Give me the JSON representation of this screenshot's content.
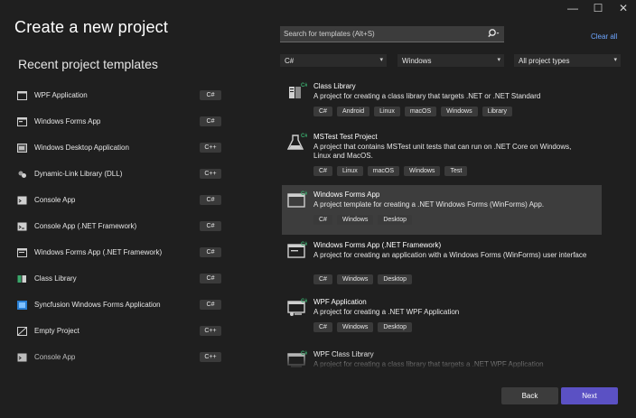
{
  "window": {
    "controls": {
      "minimize": "—",
      "maximize": "☐",
      "close": "✕"
    }
  },
  "page": {
    "title": "Create a new project"
  },
  "recent": {
    "heading": "Recent project templates",
    "items": [
      {
        "label": "WPF Application",
        "lang": "C#",
        "icon": "wpf-window-icon"
      },
      {
        "label": "Windows Forms App",
        "lang": "C#",
        "icon": "winforms-window-icon"
      },
      {
        "label": "Windows Desktop Application",
        "lang": "C++",
        "icon": "desktop-app-icon"
      },
      {
        "label": "Dynamic-Link Library (DLL)",
        "lang": "C++",
        "icon": "dll-icon"
      },
      {
        "label": "Console App",
        "lang": "C#",
        "icon": "console-icon"
      },
      {
        "label": "Console App (.NET Framework)",
        "lang": "C#",
        "icon": "console-framework-icon"
      },
      {
        "label": "Windows Forms App (.NET Framework)",
        "lang": "C#",
        "icon": "winforms-framework-icon"
      },
      {
        "label": "Class Library",
        "lang": "C#",
        "icon": "class-library-icon"
      },
      {
        "label": "Syncfusion Windows Forms Application",
        "lang": "C#",
        "icon": "syncfusion-icon"
      },
      {
        "label": "Empty Project",
        "lang": "C++",
        "icon": "empty-project-icon"
      },
      {
        "label": "Console App",
        "lang": "C++",
        "icon": "console-cpp-icon"
      }
    ]
  },
  "search": {
    "placeholder": "Search for templates (Alt+S)",
    "clear_all": "Clear all"
  },
  "filters": {
    "language": "C#",
    "platform": "Windows",
    "project_type": "All project types"
  },
  "templates": [
    {
      "name": "Class Library",
      "description": "A project for creating a class library that targets .NET or .NET Standard",
      "tags": [
        "C#",
        "Android",
        "Linux",
        "macOS",
        "Windows",
        "Library"
      ],
      "icon": "class-library-icon"
    },
    {
      "name": "MSTest Test Project",
      "description": "A project that contains MSTest unit tests that can run on .NET Core on Windows, Linux and MacOS.",
      "tags": [
        "C#",
        "Linux",
        "macOS",
        "Windows",
        "Test"
      ],
      "icon": "test-flask-icon"
    },
    {
      "name": "Windows Forms App",
      "description": "A project template for creating a .NET Windows Forms (WinForms) App.",
      "tags": [
        "C#",
        "Windows",
        "Desktop"
      ],
      "icon": "winforms-window-icon",
      "selected": true
    },
    {
      "name": "Windows Forms App (.NET Framework)",
      "description": "A project for creating an application with a Windows Forms (WinForms) user interface",
      "tags": [
        "C#",
        "Windows",
        "Desktop"
      ],
      "icon": "winforms-framework-icon"
    },
    {
      "name": "WPF Application",
      "description": "A project for creating a .NET WPF Application",
      "tags": [
        "C#",
        "Windows",
        "Desktop"
      ],
      "icon": "wpf-window-icon"
    },
    {
      "name": "WPF Class Library",
      "description": "A project for creating a class library that targets a .NET WPF Application",
      "tags": [],
      "icon": "wpf-class-library-icon"
    }
  ],
  "buttons": {
    "back": "Back",
    "next": "Next"
  },
  "colors": {
    "background": "#1f1f1f",
    "accent": "#5b51c4",
    "link": "#6ea6ff",
    "selected_row": "#3d3d3d"
  }
}
